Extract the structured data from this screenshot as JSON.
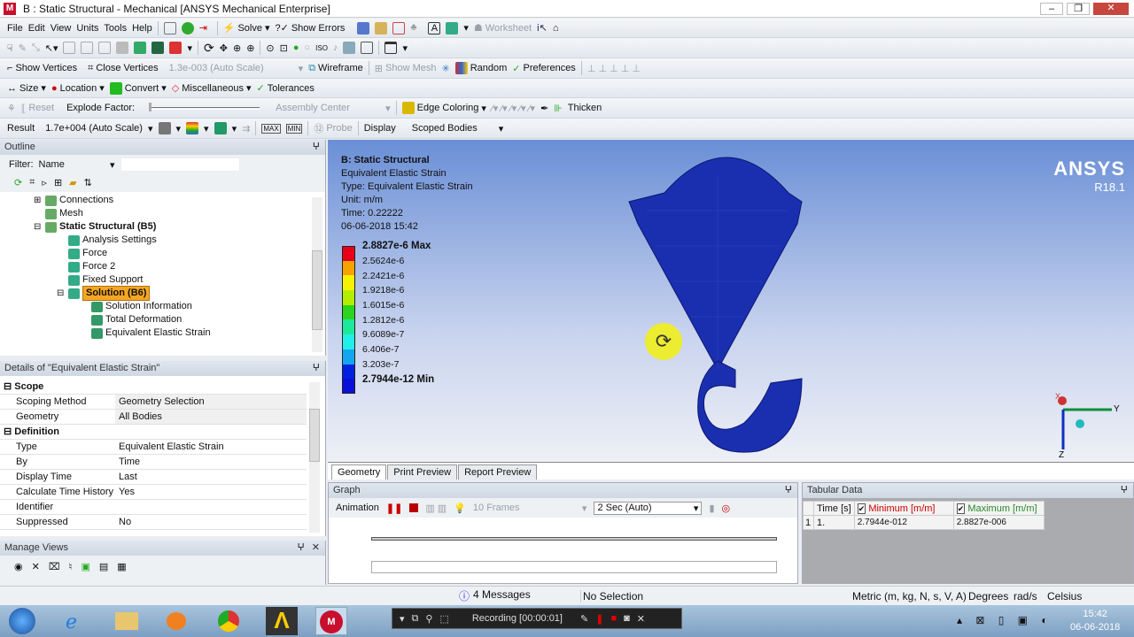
{
  "window": {
    "title": "B : Static Structural - Mechanical [ANSYS Mechanical Enterprise]"
  },
  "menu": [
    "File",
    "Edit",
    "View",
    "Units",
    "Tools",
    "Help"
  ],
  "toolbar1": {
    "solve": "Solve",
    "show_errors": "Show Errors",
    "worksheet": "Worksheet"
  },
  "toolbar3": {
    "show_vertices": "Show Vertices",
    "close_vertices": "Close Vertices",
    "scale": "1.3e-003 (Auto Scale)",
    "wireframe": "Wireframe",
    "show_mesh": "Show Mesh",
    "random": "Random",
    "preferences": "Preferences"
  },
  "toolbar4": {
    "size": "Size",
    "location": "Location",
    "convert": "Convert",
    "misc": "Miscellaneous",
    "tolerances": "Tolerances"
  },
  "toolbar5": {
    "reset": "Reset",
    "explode": "Explode Factor:",
    "assembly": "Assembly Center",
    "edge": "Edge Coloring",
    "thicken": "Thicken"
  },
  "toolbar6": {
    "result": "Result",
    "scale": "1.7e+004 (Auto Scale)",
    "probe": "Probe",
    "display": "Display",
    "scoped": "Scoped Bodies"
  },
  "outline": {
    "title": "Outline",
    "filter_label": "Filter:",
    "filter_value": "Name",
    "items": [
      {
        "label": "Connections",
        "indent": 1
      },
      {
        "label": "Mesh",
        "indent": 1
      },
      {
        "label": "Static Structural (B5)",
        "indent": 1
      },
      {
        "label": "Analysis Settings",
        "indent": 2
      },
      {
        "label": "Force",
        "indent": 2
      },
      {
        "label": "Force 2",
        "indent": 2
      },
      {
        "label": "Fixed Support",
        "indent": 2
      },
      {
        "label": "Solution (B6)",
        "indent": 2
      },
      {
        "label": "Solution Information",
        "indent": 3
      },
      {
        "label": "Total Deformation",
        "indent": 3
      },
      {
        "label": "Equivalent Elastic Strain",
        "indent": 3
      }
    ]
  },
  "details": {
    "title": "Details of \"Equivalent Elastic Strain\"",
    "rows": [
      {
        "k": "Scope",
        "section": true
      },
      {
        "k": "Scoping Method",
        "v": "Geometry Selection"
      },
      {
        "k": "Geometry",
        "v": "All Bodies"
      },
      {
        "k": "Definition",
        "section": true
      },
      {
        "k": "Type",
        "v": "Equivalent Elastic Strain"
      },
      {
        "k": "By",
        "v": "Time"
      },
      {
        "k": "Display Time",
        "v": "Last"
      },
      {
        "k": "Calculate Time History",
        "v": "Yes"
      },
      {
        "k": "Identifier",
        "v": ""
      },
      {
        "k": "Suppressed",
        "v": "No"
      }
    ]
  },
  "manage_views": "Manage Views",
  "viewport": {
    "title": "B: Static Structural",
    "lines": [
      "Equivalent Elastic Strain",
      "Type: Equivalent Elastic Strain",
      "Unit: m/m",
      "Time: 0.22222",
      "06-06-2018 15:42"
    ],
    "legend": [
      {
        "label": "2.8827e-6 Max",
        "color": "#e8001a",
        "bold": true
      },
      {
        "label": "2.5624e-6",
        "color": "#f7a200"
      },
      {
        "label": "2.2421e-6",
        "color": "#f6f200"
      },
      {
        "label": "1.9218e-6",
        "color": "#b3ee00"
      },
      {
        "label": "1.6015e-6",
        "color": "#2ad41f"
      },
      {
        "label": "1.2812e-6",
        "color": "#1ee89a"
      },
      {
        "label": "9.6089e-7",
        "color": "#20f0e8"
      },
      {
        "label": "6.406e-7",
        "color": "#13a6f0"
      },
      {
        "label": "3.203e-7",
        "color": "#0020e0"
      },
      {
        "label": "2.7944e-12 Min",
        "bold": true
      }
    ],
    "brand": "ANSYS",
    "version": "R18.1",
    "axes": {
      "x": "X",
      "y": "Y",
      "z": "Z"
    }
  },
  "view_tabs": [
    "Geometry",
    "Print Preview",
    "Report Preview"
  ],
  "graph": {
    "title": "Graph",
    "animation": "Animation",
    "frames": "10 Frames",
    "duration": "2 Sec (Auto)"
  },
  "tabular": {
    "title": "Tabular Data",
    "headers": [
      "Time [s]",
      "Minimum [m/m]",
      "Maximum [m/m]"
    ],
    "rows": [
      [
        "1",
        "1.",
        "2.7944e-012",
        "2.8827e-006"
      ]
    ]
  },
  "status": {
    "messages": "4 Messages",
    "selection": "No Selection",
    "units": "Metric (m, kg, N, s, V, A)",
    "angle": "Degrees",
    "rot": "rad/s",
    "temp": "Celsius"
  },
  "taskbar": {
    "recording": "Recording [00:00:01]",
    "time": "15:42",
    "date": "06-06-2018"
  }
}
